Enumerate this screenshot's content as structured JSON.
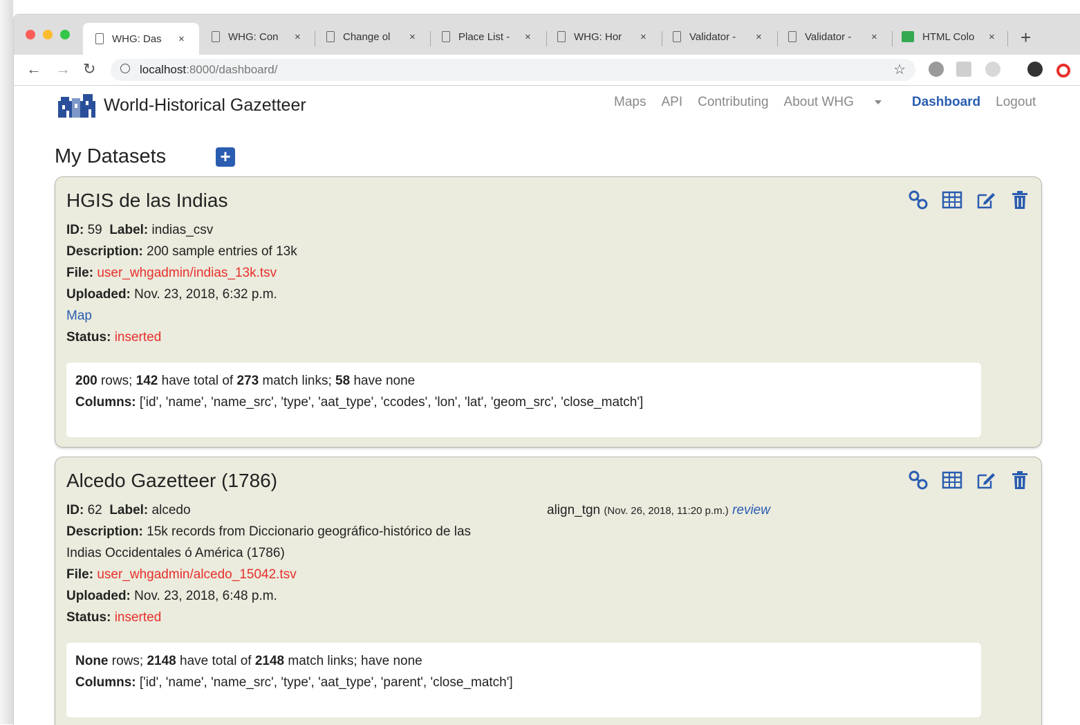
{
  "browser": {
    "tabs": [
      {
        "title": "WHG: Das"
      },
      {
        "title": "WHG: Con"
      },
      {
        "title": "Change ol"
      },
      {
        "title": "Place List -"
      },
      {
        "title": "WHG: Hor"
      },
      {
        "title": "Validator -"
      },
      {
        "title": "Validator -"
      },
      {
        "title": "HTML Colo"
      }
    ],
    "close_glyph": "×",
    "new_tab": "+",
    "url_host": "localhost",
    "url_path": ":8000/dashboard/"
  },
  "site": {
    "name": "World-Historical Gazetteer",
    "nav": [
      "Maps",
      "API",
      "Contributing",
      "About WHG",
      "Dashboard",
      "Logout"
    ]
  },
  "page": {
    "section_title": "My Datasets",
    "add_label": "+"
  },
  "datasets": [
    {
      "title": "HGIS de las Indias",
      "id_label": "ID:",
      "id": "59",
      "label_label": "Label:",
      "label": "indias_csv",
      "description_label": "Description:",
      "description": "200 sample entries of 13k",
      "file_label": "File:",
      "file": "user_whgadmin/indias_13k.tsv",
      "uploaded_label": "Uploaded:",
      "uploaded": "Nov. 23, 2018, 6:32 p.m.",
      "map_link": "Map",
      "status_label": "Status:",
      "status": "inserted",
      "summary": {
        "rows": "200",
        "rows_text": "rows;",
        "have": "142",
        "have_text": "have total of",
        "links": "273",
        "links_text": "match links;",
        "none": "58",
        "none_text": "have none"
      },
      "columns_label": "Columns:",
      "columns": "['id', 'name', 'name_src', 'type', 'aat_type', 'ccodes', 'lon', 'lat', 'geom_src', 'close_match']"
    },
    {
      "title": "Alcedo Gazetteer (1786)",
      "id_label": "ID:",
      "id": "62",
      "label_label": "Label:",
      "label": "alcedo",
      "description_label": "Description:",
      "description_1": "15k records from Diccionario geográfico-histórico de las",
      "description_2": "Indias Occidentales ó América (1786)",
      "file_label": "File:",
      "file": "user_whgadmin/alcedo_15042.tsv",
      "uploaded_label": "Uploaded:",
      "uploaded": "Nov. 23, 2018, 6:48 p.m.",
      "status_label": "Status:",
      "status": "inserted",
      "task": {
        "name": "align_tgn",
        "date": "(Nov. 26, 2018, 11:20 p.m.)",
        "link": "review"
      },
      "summary": {
        "rows": "None",
        "rows_text": "rows;",
        "have": "2148",
        "have_text": "have total of",
        "links": "2148",
        "links_text": "match links;",
        "none": "",
        "none_text": "have none"
      },
      "columns_label": "Columns:",
      "columns": "['id', 'name', 'name_src', 'type', 'aat_type', 'parent', 'close_match']"
    }
  ],
  "colors": {
    "accent": "#2a5db0",
    "status": "#e8302a",
    "card_bg": "#ebebde"
  }
}
